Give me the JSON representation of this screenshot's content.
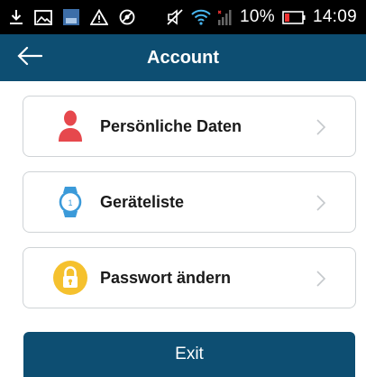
{
  "status_bar": {
    "battery": "10%",
    "time": "14:09",
    "icons": [
      "download-icon",
      "image-icon",
      "app-icon",
      "warning-icon",
      "blocked-icon",
      "mute-icon",
      "wifi-icon",
      "signal-icon",
      "battery-icon"
    ]
  },
  "app_bar": {
    "title": "Account",
    "back_icon": "arrow-left-icon",
    "color": "#0d4e72"
  },
  "menu": [
    {
      "label": "Persönliche Daten",
      "icon": "person-icon",
      "icon_color": "#e6484d"
    },
    {
      "label": "Geräteliste",
      "icon": "watch-icon",
      "icon_color": "#3b9ad9"
    },
    {
      "label": "Passwort ändern",
      "icon": "lock-icon",
      "icon_color": "#f5c12e"
    }
  ],
  "exit_label": "Exit"
}
